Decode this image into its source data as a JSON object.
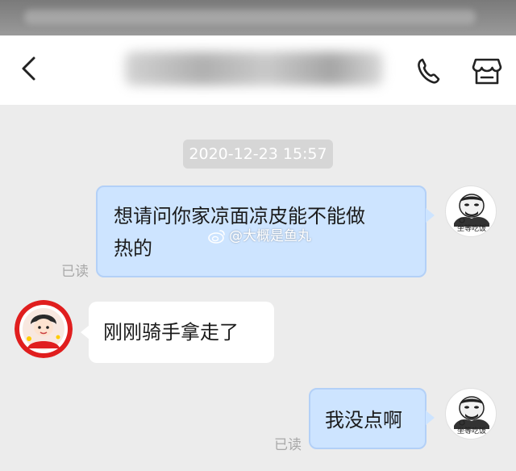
{
  "header": {
    "back_icon": "chevron-left-icon",
    "call_icon": "phone-icon",
    "shop_icon": "storefront-icon"
  },
  "timestamp": "2020-12-23 15:57",
  "messages": [
    {
      "side": "sent",
      "text_line1": "想请问你家凉面凉皮能不能做",
      "text_line2": "热的",
      "status": "已读"
    },
    {
      "side": "received",
      "text": "刚刚骑手拿走了"
    },
    {
      "side": "sent",
      "text": "我没点啊",
      "status": "已读"
    }
  ],
  "my_avatar": {
    "caption": "坐等吃饭"
  },
  "watermark": {
    "icon": "weibo-icon",
    "text": "@大概是鱼丸"
  },
  "colors": {
    "sent_bubble": "#cde4ff",
    "received_bubble": "#ffffff",
    "background": "#ececec",
    "timestamp_bg": "#d6d6d6"
  }
}
